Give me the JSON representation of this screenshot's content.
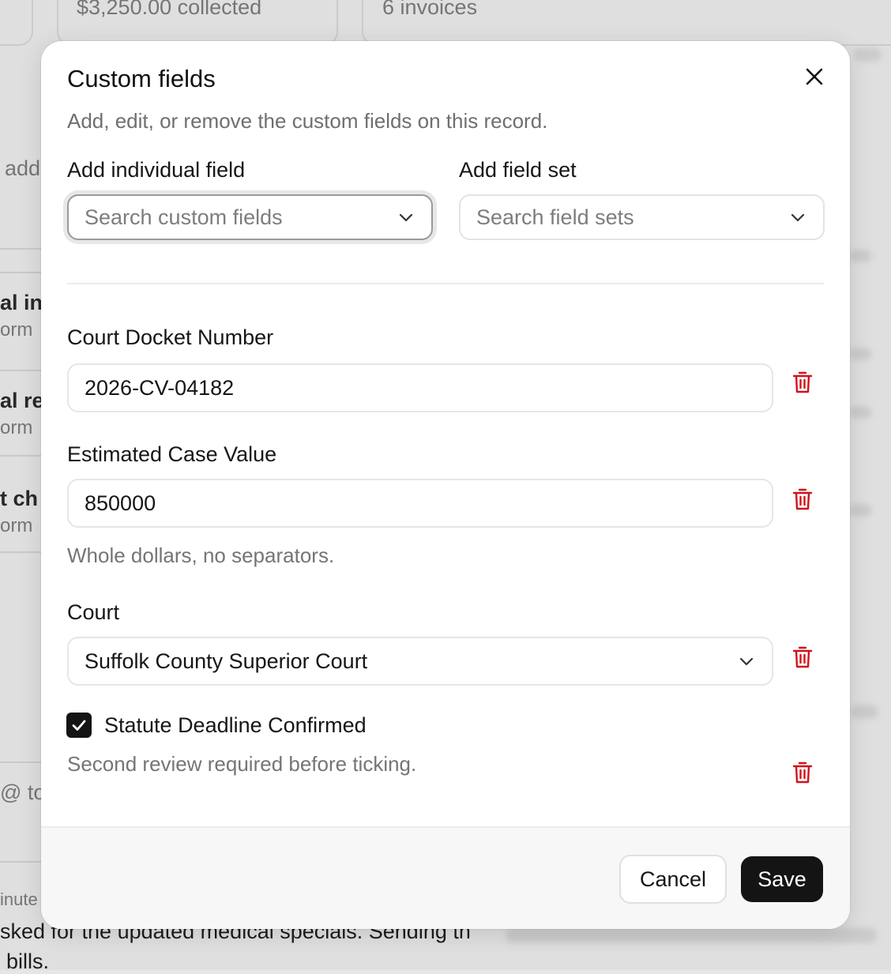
{
  "background": {
    "card1_text": "$3,250.00 collected",
    "card2_text": "6 invoices",
    "side_text": "add",
    "rows": [
      {
        "title": "al in",
        "sub": "orm"
      },
      {
        "title": "al rec",
        "sub": "orm"
      },
      {
        "title": "t ch",
        "sub": "orm"
      }
    ],
    "mention_text": "@ to",
    "minute_text": "inute",
    "note_line1": "sked for the updated medical specials. Sending th",
    "note_line2": "bills."
  },
  "modal": {
    "title": "Custom fields",
    "subtitle": "Add, edit, or remove the custom fields on this record.",
    "add_individual": {
      "label": "Add individual field",
      "placeholder": "Search custom fields"
    },
    "add_set": {
      "label": "Add field set",
      "placeholder": "Search field sets"
    },
    "fields": {
      "docket": {
        "label": "Court Docket Number",
        "value": "2026-CV-04182"
      },
      "case_value": {
        "label": "Estimated Case Value",
        "value": "850000",
        "hint": "Whole dollars, no separators."
      },
      "court": {
        "label": "Court",
        "value": "Suffolk County Superior Court"
      },
      "statute": {
        "label": "Statute Deadline Confirmed",
        "checked": true,
        "hint": "Second review required before ticking."
      }
    },
    "footer": {
      "cancel_label": "Cancel",
      "save_label": "Save"
    }
  },
  "colors": {
    "accent_dark": "#141414",
    "delete_red": "#d0121b"
  },
  "icons": [
    "close-icon",
    "chevron-down-icon",
    "trash-icon",
    "check-icon"
  ]
}
